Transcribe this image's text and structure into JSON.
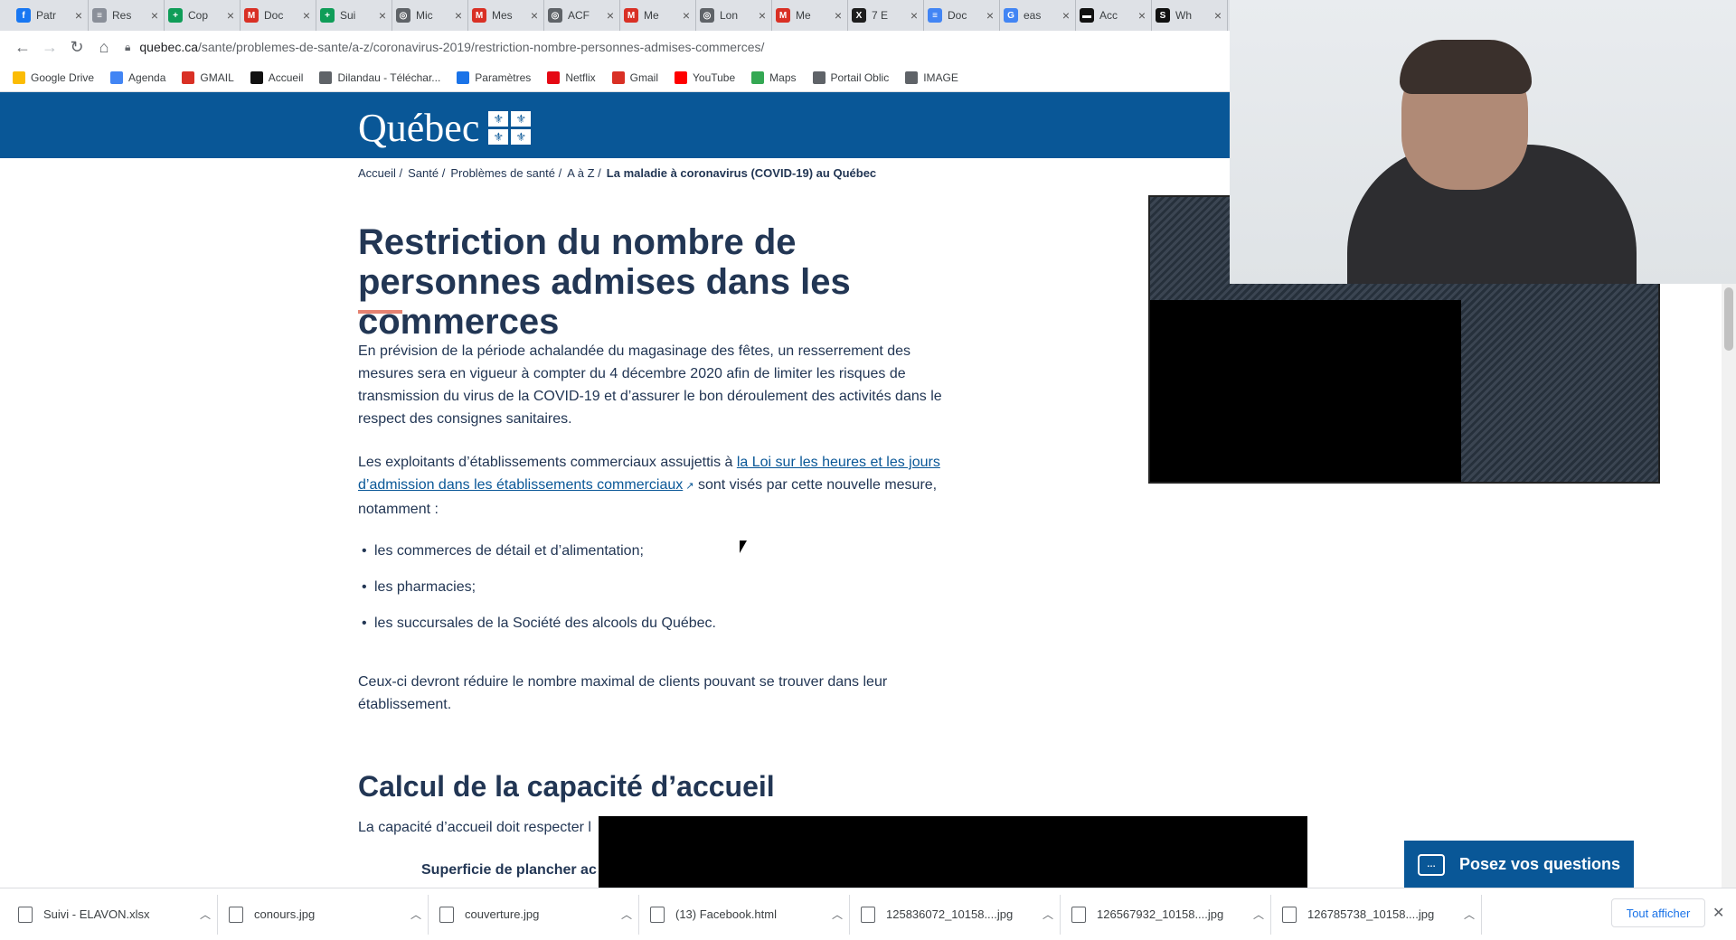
{
  "browser": {
    "tabs": [
      {
        "label": "Patr",
        "icon": "facebook-icon",
        "color": "#1877f2",
        "glyph": "f"
      },
      {
        "label": "Res",
        "icon": "page-icon",
        "color": "#8a8f99",
        "glyph": "≡"
      },
      {
        "label": "Cop",
        "icon": "sheets-icon",
        "color": "#0f9d58",
        "glyph": "+"
      },
      {
        "label": "Doc",
        "icon": "gmail-icon",
        "color": "#d93025",
        "glyph": "M"
      },
      {
        "label": "Sui",
        "icon": "sheets-icon",
        "color": "#0f9d58",
        "glyph": "+"
      },
      {
        "label": "Mic",
        "icon": "globe-icon",
        "color": "#5f6368",
        "glyph": "◎"
      },
      {
        "label": "Mes",
        "icon": "gmail-icon",
        "color": "#d93025",
        "glyph": "M"
      },
      {
        "label": "ACF",
        "icon": "globe-icon",
        "color": "#5f6368",
        "glyph": "◎"
      },
      {
        "label": "Me",
        "icon": "gmail-icon",
        "color": "#d93025",
        "glyph": "M"
      },
      {
        "label": "Lon",
        "icon": "globe-icon",
        "color": "#5f6368",
        "glyph": "◎"
      },
      {
        "label": "Me",
        "icon": "gmail-icon",
        "color": "#d93025",
        "glyph": "M"
      },
      {
        "label": "7 E",
        "icon": "x-icon",
        "color": "#1d1d1d",
        "glyph": "X"
      },
      {
        "label": "Doc",
        "icon": "docs-icon",
        "color": "#4285f4",
        "glyph": "≡"
      },
      {
        "label": "eas",
        "icon": "google-icon",
        "color": "#4285f4",
        "glyph": "G"
      },
      {
        "label": "Acc",
        "icon": "page-icon",
        "color": "#111111",
        "glyph": "▬"
      },
      {
        "label": "Wh",
        "icon": "sbs-icon",
        "color": "#111111",
        "glyph": "S"
      }
    ],
    "url_domain": "quebec.ca",
    "url_path": "/sante/problemes-de-sante/a-z/coronavirus-2019/restriction-nombre-personnes-admises-commerces/",
    "bookmarks": [
      {
        "label": "Google Drive",
        "icon": "drive-icon",
        "color": "#fbbc04"
      },
      {
        "label": "Agenda",
        "icon": "calendar-icon",
        "color": "#4285f4"
      },
      {
        "label": "GMAIL",
        "icon": "gmail-icon",
        "color": "#d93025"
      },
      {
        "label": "Accueil",
        "icon": "page-icon",
        "color": "#111111"
      },
      {
        "label": "Dilandau - Téléchar...",
        "icon": "globe-icon",
        "color": "#5f6368"
      },
      {
        "label": "Paramètres",
        "icon": "gear-icon",
        "color": "#1a73e8"
      },
      {
        "label": "Netflix",
        "icon": "netflix-icon",
        "color": "#e50914"
      },
      {
        "label": "Gmail",
        "icon": "gmail-icon",
        "color": "#d93025"
      },
      {
        "label": "YouTube",
        "icon": "youtube-icon",
        "color": "#ff0000"
      },
      {
        "label": "Maps",
        "icon": "maps-icon",
        "color": "#34a853"
      },
      {
        "label": "Portail Oblic",
        "icon": "portal-icon",
        "color": "#5f6368"
      },
      {
        "label": "IMAGE",
        "icon": "globe-icon",
        "color": "#5f6368"
      }
    ]
  },
  "header": {
    "logo_text": "Québec",
    "brand_color": "#095797"
  },
  "breadcrumb": {
    "items": [
      "Accueil /",
      "Santé /",
      "Problèmes de santé /",
      "A à Z /"
    ],
    "current": "La maladie à coronavirus (COVID-19) au Québec"
  },
  "main": {
    "title": "Restriction du nombre de personnes admises dans les commerces",
    "para1": "En prévision de la période achalandée du magasinage des fêtes, un resserrement des mesures sera en vigueur à compter du 4 décembre 2020 afin de limiter les risques de transmission du virus de la COVID-19 et d’assurer le bon déroulement des activités dans le respect des consignes sanitaires.",
    "para2_before": "Les exploitants d’établissements commerciaux assujettis à ",
    "para2_link": "la Loi sur les heures et les jours d’admission dans les établissements commerciaux",
    "para2_after": " sont visés par cette nouvelle mesure, notamment :",
    "list": [
      "les commerces de détail et d’alimentation;",
      "les pharmacies;",
      "les succursales de la Société des alcools du Québec."
    ],
    "para3": "Ceux-ci devront réduire le nombre maximal de clients pouvant se trouver dans leur établissement.",
    "h2": "Calcul de la capacité d’accueil",
    "para4": "La capacité d’accueil doit respecter l",
    "subhead": "Superficie de plancher ac"
  },
  "ask_button": "Posez vos questions",
  "downloads": [
    {
      "name": "Suivi - ELAVON.xlsx",
      "icon": "excel-file-icon"
    },
    {
      "name": "conours.jpg",
      "icon": "image-file-icon"
    },
    {
      "name": "couverture.jpg",
      "icon": "image-file-icon"
    },
    {
      "name": "(13) Facebook.html",
      "icon": "chrome-file-icon"
    },
    {
      "name": "125836072_10158....jpg",
      "icon": "image-file-icon"
    },
    {
      "name": "126567932_10158....jpg",
      "icon": "image-file-icon"
    },
    {
      "name": "126785738_10158....jpg",
      "icon": "image-file-icon"
    }
  ],
  "show_all": "Tout afficher"
}
